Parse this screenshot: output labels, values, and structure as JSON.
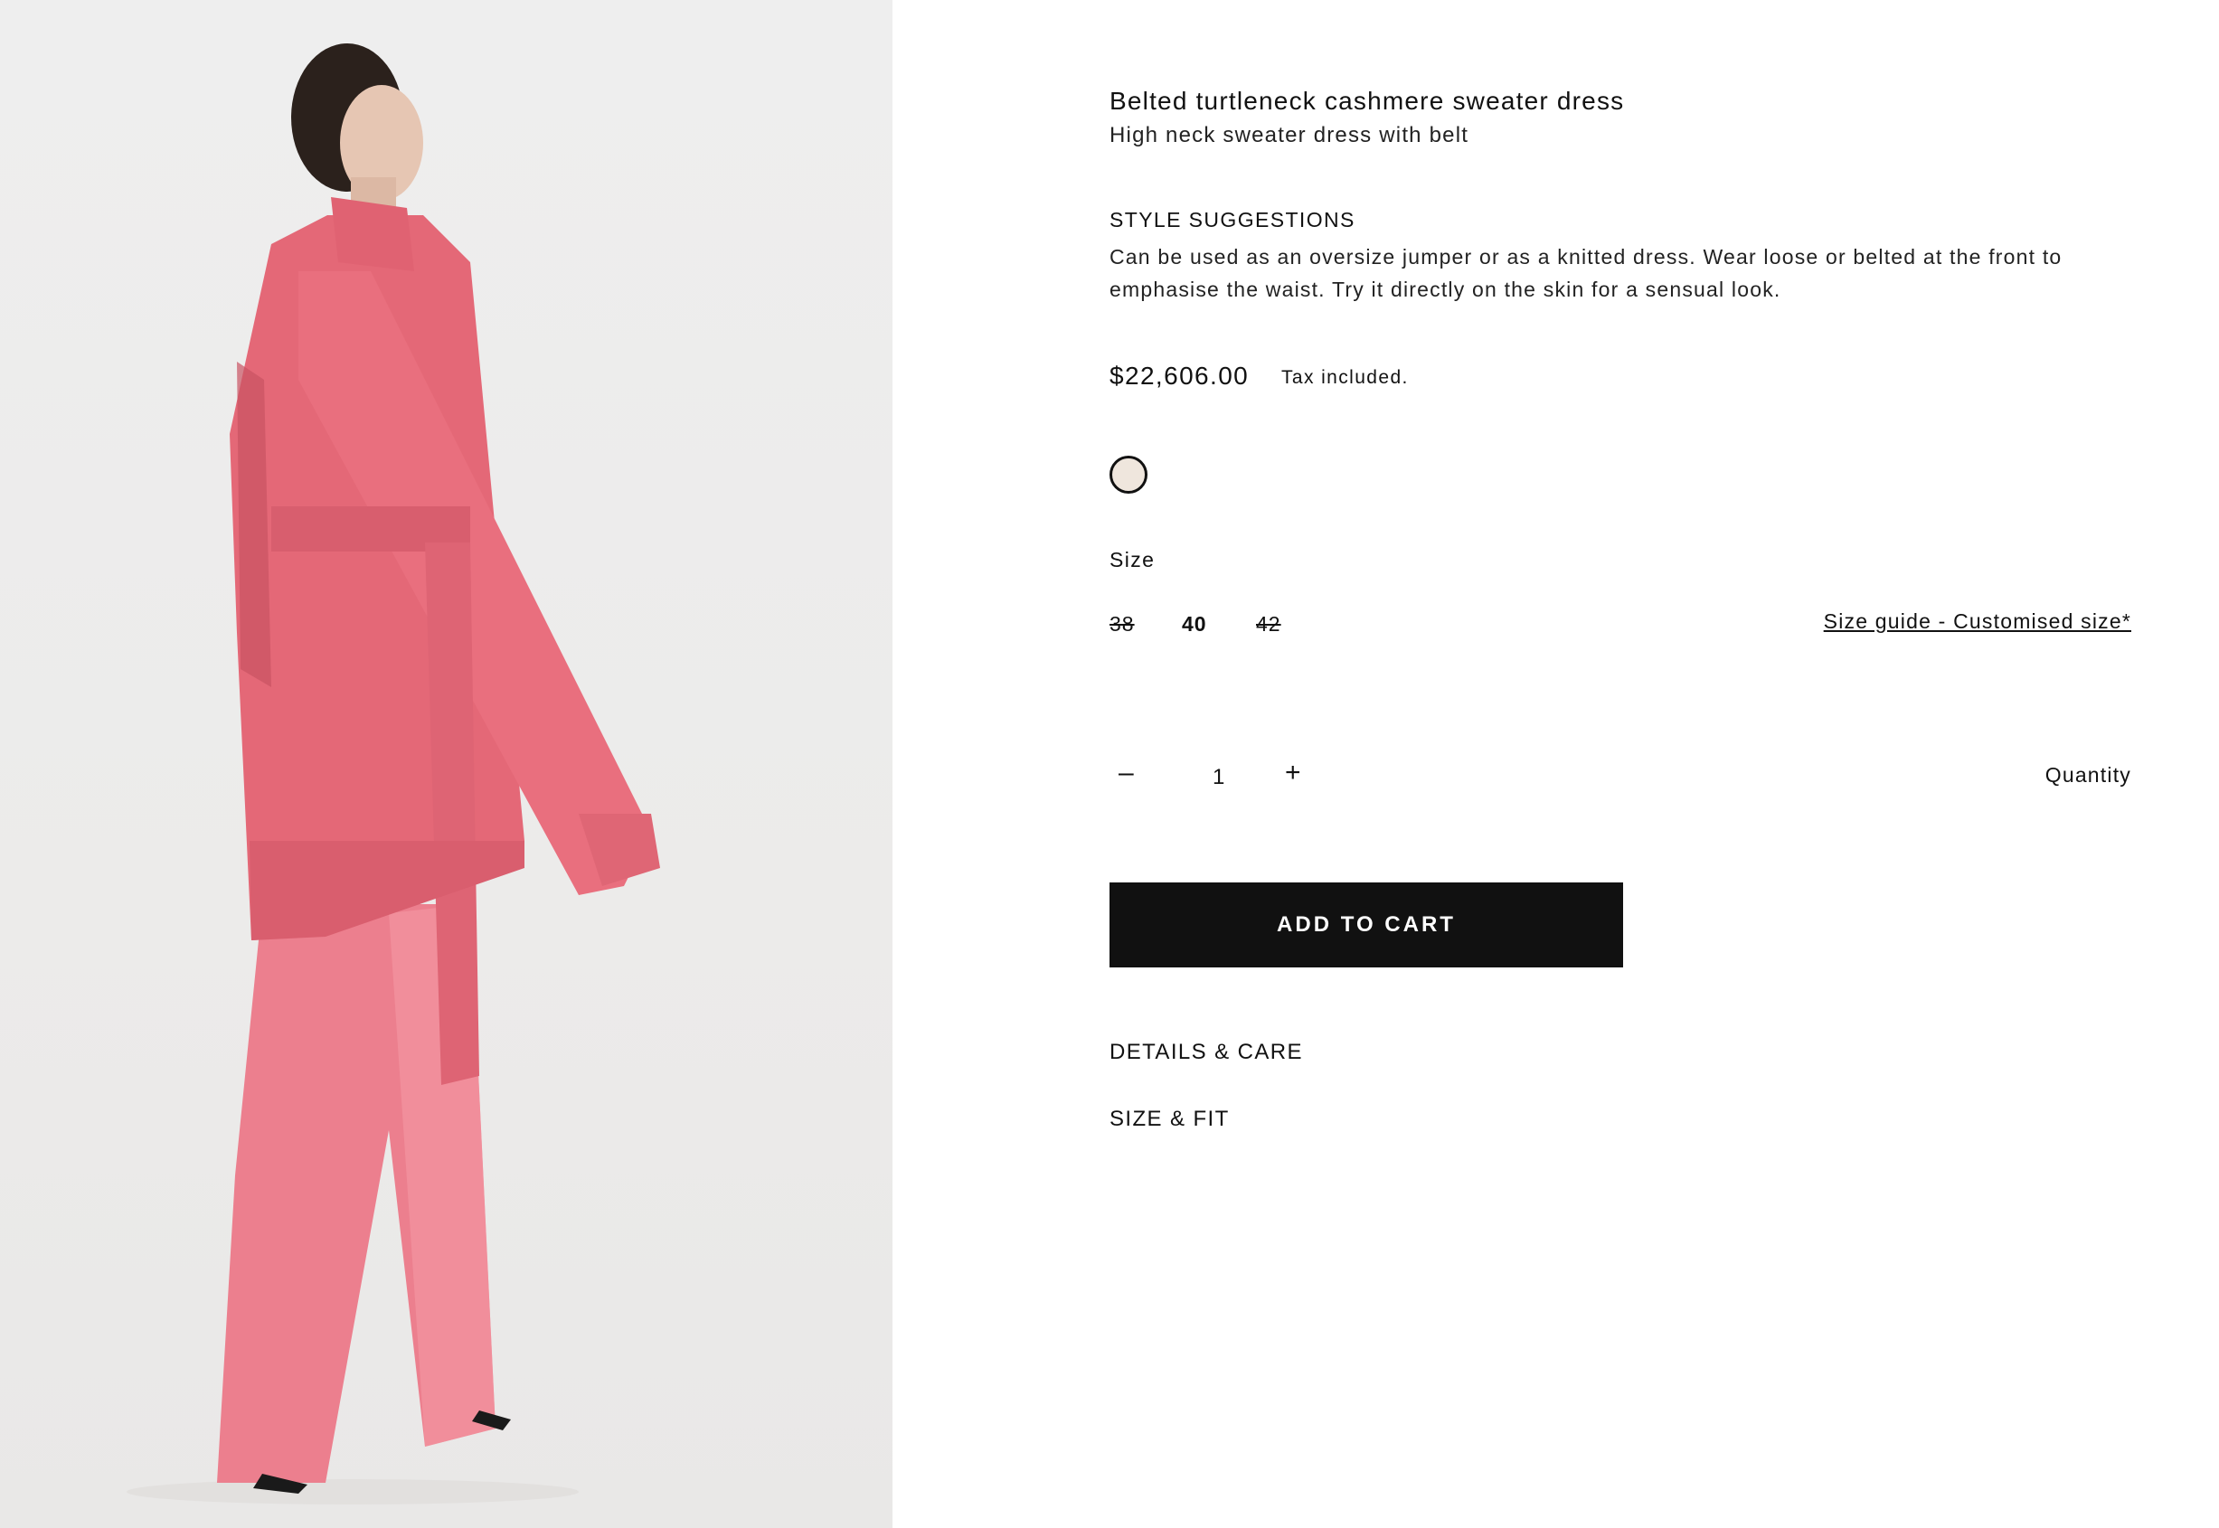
{
  "product": {
    "title": "Belted turtleneck cashmere sweater dress",
    "subtitle": "High neck sweater dress with belt",
    "image_alt": "model wearing pink belted turtleneck sweater dress with pink satin trousers"
  },
  "style_suggestions": {
    "heading": "STYLE SUGGESTIONS",
    "text": "Can be used as an oversize jumper or as a knitted dress. Wear loose or belted at the front to emphasise the waist. Try it directly on the skin for a sensual look."
  },
  "pricing": {
    "price": "$22,606.00",
    "tax_note": "Tax included."
  },
  "color": {
    "swatch_hex": "#efe6dd"
  },
  "size": {
    "label": "Size",
    "options": [
      {
        "label": "38",
        "available": false,
        "selected": false
      },
      {
        "label": "40",
        "available": true,
        "selected": true
      },
      {
        "label": "42",
        "available": false,
        "selected": false
      }
    ],
    "guide_link": "Size guide - Customised size*"
  },
  "quantity": {
    "minus": "–",
    "value": "1",
    "plus": "+",
    "label": "Quantity"
  },
  "cart": {
    "button_label": "ADD TO CART"
  },
  "accordions": {
    "details_care": "DETAILS & CARE",
    "size_fit": "SIZE & FIT"
  },
  "colors": {
    "background": "#ffffff",
    "button_bg": "#111111",
    "button_text": "#ffffff",
    "image_bg": "#eeeeee",
    "garment_pink": "#e8707c"
  }
}
